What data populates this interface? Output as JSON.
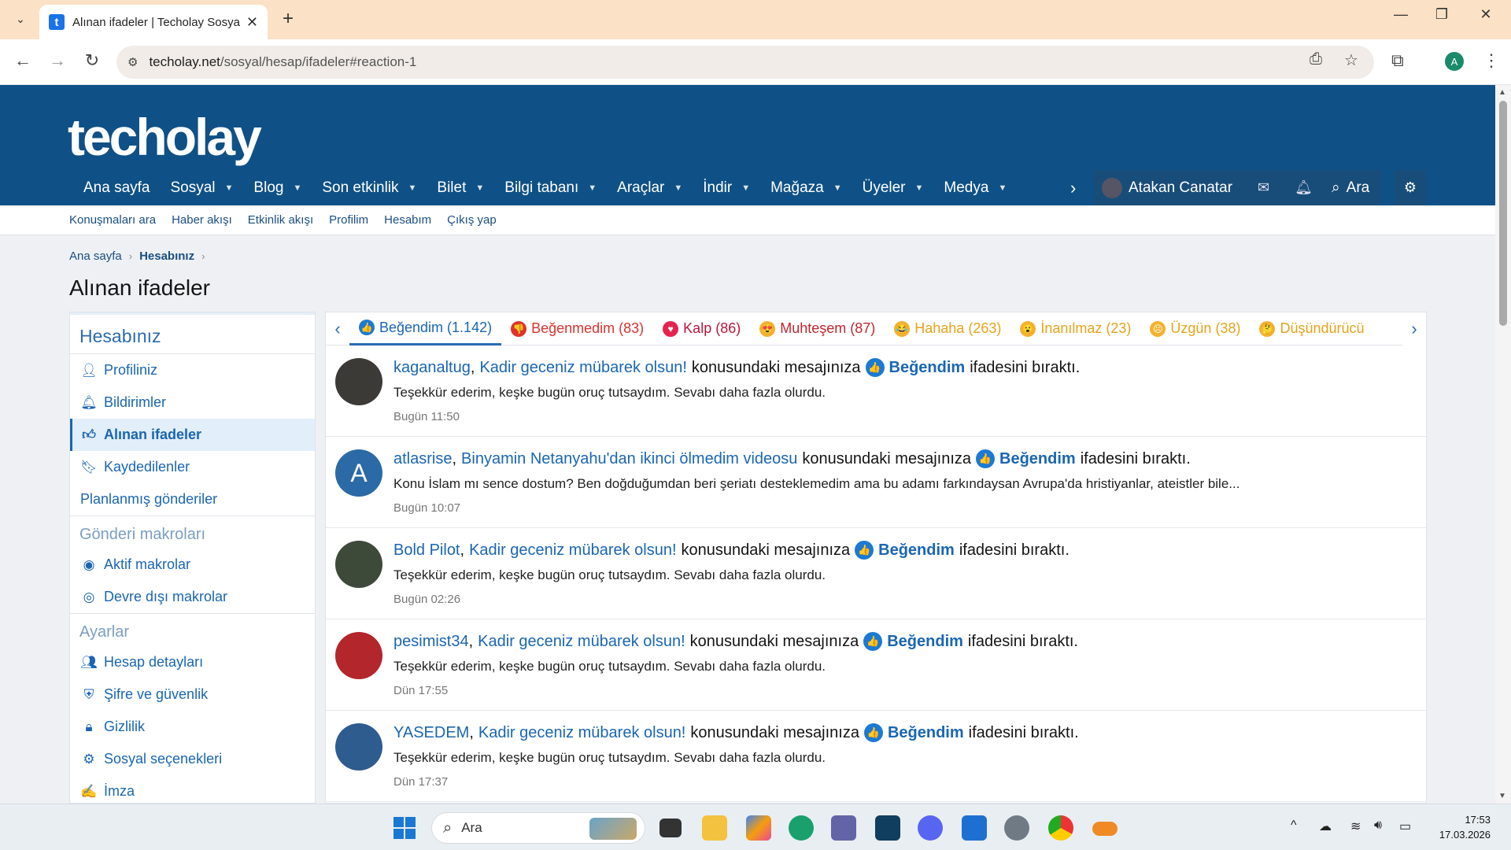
{
  "browser": {
    "tab_title": "Alınan ifadeler | Techolay Sosyal",
    "url_host": "techolay.net",
    "url_path": "/sosyal/hesap/ifadeler#reaction-1",
    "profile_initial": "A"
  },
  "site": {
    "logo": "techolay",
    "nav": [
      {
        "label": "Ana sayfa",
        "dropdown": false
      },
      {
        "label": "Sosyal",
        "dropdown": true
      },
      {
        "label": "Blog",
        "dropdown": true
      },
      {
        "label": "Son etkinlik",
        "dropdown": true
      },
      {
        "label": "Bilet",
        "dropdown": true
      },
      {
        "label": "Bilgi tabanı",
        "dropdown": true
      },
      {
        "label": "Araçlar",
        "dropdown": true
      },
      {
        "label": "İndir",
        "dropdown": true
      },
      {
        "label": "Mağaza",
        "dropdown": true
      },
      {
        "label": "Üyeler",
        "dropdown": true
      },
      {
        "label": "Medya",
        "dropdown": true
      }
    ],
    "user_name": "Atakan Canatar",
    "search_label": "Ara",
    "subnav": [
      "Konuşmaları ara",
      "Haber akışı",
      "Etkinlik akışı",
      "Profilim",
      "Hesabım",
      "Çıkış yap"
    ]
  },
  "breadcrumb": {
    "home": "Ana sayfa",
    "current": "Hesabınız"
  },
  "page_title": "Alınan ifadeler",
  "sidebar": {
    "section1_title": "Hesabınız",
    "items1": [
      {
        "label": "Profiliniz",
        "icon": "user-icon"
      },
      {
        "label": "Bildirimler",
        "icon": "bell-icon"
      },
      {
        "label": "Alınan ifadeler",
        "icon": "thumbs-up-icon",
        "active": true
      },
      {
        "label": "Kaydedilenler",
        "icon": "bookmark-icon"
      },
      {
        "label": "Planlanmış gönderiler",
        "icon": ""
      }
    ],
    "section2_title": "Gönderi makroları",
    "items2": [
      {
        "label": "Aktif makrolar",
        "icon": "toggle-on-icon"
      },
      {
        "label": "Devre dışı makrolar",
        "icon": "toggle-off-icon"
      }
    ],
    "section3_title": "Ayarlar",
    "items3": [
      {
        "label": "Hesap detayları",
        "icon": "user-cog-icon"
      },
      {
        "label": "Şifre ve güvenlik",
        "icon": "shield-icon"
      },
      {
        "label": "Gizlilik",
        "icon": "lock-icon"
      },
      {
        "label": "Sosyal seçenekleri",
        "icon": "cogs-icon"
      },
      {
        "label": "İmza",
        "icon": "signature-icon"
      }
    ]
  },
  "reaction_tabs": [
    {
      "label": "Beğendim (1.142)",
      "color": "#1a66b2",
      "emoji_bg": "#1a7ad4",
      "glyph": "👍",
      "active": true
    },
    {
      "label": "Beğenmedim (83)",
      "color": "#d9322c",
      "emoji_bg": "#e0332b",
      "glyph": "👎"
    },
    {
      "label": "Kalp (86)",
      "color": "#b5163a",
      "emoji_bg": "#e3244f",
      "glyph": "♥"
    },
    {
      "label": "Muhteşem (87)",
      "color": "#c0262d",
      "emoji_bg": "#f2b230",
      "glyph": "😍"
    },
    {
      "label": "Hahaha (263)",
      "color": "#e6a31b",
      "emoji_bg": "#f2b230",
      "glyph": "😂"
    },
    {
      "label": "İnanılmaz (23)",
      "color": "#e6a31b",
      "emoji_bg": "#f2b230",
      "glyph": "😮"
    },
    {
      "label": "Üzgün (38)",
      "color": "#e6a31b",
      "emoji_bg": "#f2b230",
      "glyph": "☹"
    },
    {
      "label": "Düşündürücü",
      "color": "#e6a31b",
      "emoji_bg": "#f2b230",
      "glyph": "🤔"
    }
  ],
  "items": [
    {
      "user": "kaganaltug",
      "thread": "Kadir geceniz mübarek olsun!",
      "avatar_letter": "",
      "excerpt": "Teşekkür ederim, keşke bugün oruç tutsaydım. Sevabı daha fazla olurdu.",
      "time": "Bugün 11:50"
    },
    {
      "user": "atlasrise",
      "thread": "Binyamin Netanyahu'dan ikinci ölmedim videosu",
      "avatar_letter": "A",
      "excerpt": "Konu İslam mı sence dostum? Ben doğduğumdan beri şeriatı desteklemedim ama bu adamı farkındaysan Avrupa'da hristiyanlar, ateistler bile...",
      "time": "Bugün 10:07"
    },
    {
      "user": "Bold Pilot",
      "thread": "Kadir geceniz mübarek olsun!",
      "avatar_letter": "",
      "excerpt": "Teşekkür ederim, keşke bugün oruç tutsaydım. Sevabı daha fazla olurdu.",
      "time": "Bugün 02:26"
    },
    {
      "user": "pesimist34",
      "thread": "Kadir geceniz mübarek olsun!",
      "avatar_letter": "",
      "excerpt": "Teşekkür ederim, keşke bugün oruç tutsaydım. Sevabı daha fazla olurdu.",
      "time": "Dün 17:55"
    },
    {
      "user": "YASEDEM",
      "thread": "Kadir geceniz mübarek olsun!",
      "avatar_letter": "",
      "excerpt": "Teşekkür ederim, keşke bugün oruç tutsaydım. Sevabı daha fazla olurdu.",
      "time": "Dün 17:37"
    }
  ],
  "item_text": {
    "mid": "konusundaki mesajınıza",
    "reaction": "Beğendim",
    "end": "ifadesini bıraktı."
  },
  "taskbar": {
    "search_label": "Ara",
    "time": "17:53",
    "date": "17.03.2026"
  }
}
